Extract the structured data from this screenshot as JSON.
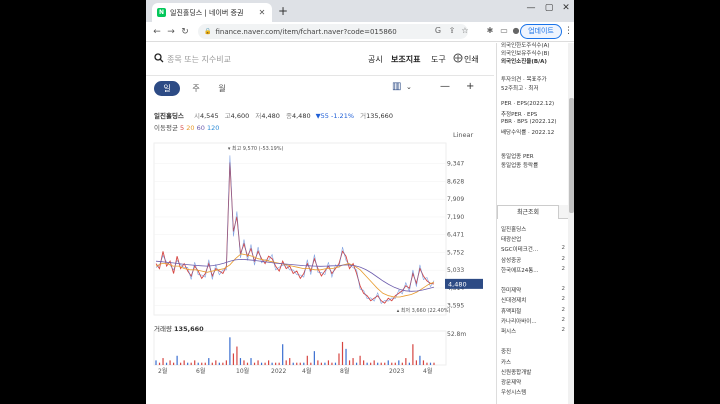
{
  "browser": {
    "tab_title": "일진홀딩스 | 네이버 증권",
    "favicon_letter": "N",
    "url": "finance.naver.com/item/fchart.naver?code=015860",
    "update_label": "업데이트"
  },
  "toolbar": {
    "search_placeholder": "종목 또는 지수비교",
    "menu": [
      "공시",
      "보조지표",
      "도구"
    ],
    "print_label": "인쇄"
  },
  "periods": [
    "일",
    "주",
    "월"
  ],
  "quote": {
    "name": "일진홀딩스",
    "open_label": "시",
    "open": "4,545",
    "high_label": "고",
    "high": "4,600",
    "low_label": "저",
    "low": "4,480",
    "close_label": "종",
    "close": "4,480",
    "change": "▼55 -1.21%",
    "volume_label": "거",
    "volume": "135,660"
  },
  "moving_average": {
    "label": "이동평균",
    "periods": [
      "5",
      "20",
      "60",
      "120"
    ]
  },
  "scale_mode": "Linear",
  "chart_data": {
    "type": "line",
    "y_ticks": [
      "9,347",
      "8,628",
      "7,909",
      "7,190",
      "6,471",
      "5,752",
      "5,033",
      "4,314",
      "3,595"
    ],
    "x_ticks": [
      "2월",
      "6월",
      "10월",
      "2022",
      "4월",
      "8월",
      "2023",
      "4월"
    ],
    "last_price": "4,480",
    "max_annotation": "최고 9,570 (-53.19%)",
    "min_annotation": "최저 3,660 (22.40%)",
    "volume_label": "거래량",
    "volume_value": "135,660",
    "volume_tick": "52.8m",
    "close": [
      5300,
      5100,
      5800,
      5200,
      5400,
      4900,
      5600,
      5100,
      5300,
      5000,
      4800,
      5200,
      5000,
      4700,
      4900,
      5300,
      4800,
      5100,
      5000,
      4900,
      5200,
      9400,
      6600,
      7200,
      5700,
      6100,
      5600,
      5900,
      5400,
      5800,
      5500,
      5300,
      5600,
      5500,
      5200,
      5000,
      5400,
      5100,
      5200,
      4900,
      5000,
      4700,
      4900,
      5300,
      5000,
      5500,
      5100,
      4800,
      5000,
      5200,
      4900,
      5100,
      5300,
      5800,
      5600,
      5100,
      5300,
      4900,
      4400,
      4100,
      4000,
      3800,
      3900,
      4000,
      3800,
      3700,
      3900,
      3800,
      4000,
      4100,
      4200,
      4400,
      4300,
      4900,
      4500,
      5100,
      4800,
      4600,
      4500,
      4480
    ],
    "ma_fast": [
      5200,
      5300,
      5300,
      5200,
      5200,
      5100,
      5050,
      5050,
      5000,
      4950,
      5000,
      5050,
      5100,
      5250,
      5500,
      5700,
      5650,
      5600,
      5500,
      5450,
      5400,
      5350,
      5300,
      5250,
      5200,
      5150,
      5100,
      5100,
      5050,
      5050,
      5100,
      5100,
      5150,
      5250,
      5300,
      5200,
      5050,
      4800,
      4550,
      4300,
      4100,
      4000,
      3950,
      3950,
      4000,
      4050,
      4150,
      4300,
      4450,
      4550
    ],
    "ma_slow": [
      5400,
      5380,
      5350,
      5330,
      5300,
      5270,
      5250,
      5230,
      5210,
      5200,
      5220,
      5260,
      5320,
      5400,
      5450,
      5470,
      5460,
      5440,
      5410,
      5380,
      5350,
      5320,
      5300,
      5280,
      5260,
      5240,
      5220,
      5210,
      5200,
      5190,
      5200,
      5210,
      5220,
      5240,
      5250,
      5220,
      5160,
      5060,
      4920,
      4760,
      4600,
      4460,
      4340,
      4250,
      4200,
      4180,
      4190,
      4230,
      4290,
      4350
    ],
    "volume": [
      2,
      1,
      3,
      1,
      2,
      1,
      4,
      1,
      2,
      1,
      1,
      2,
      1,
      1,
      1,
      3,
      1,
      2,
      1,
      1,
      2,
      12,
      5,
      8,
      3,
      2,
      1,
      3,
      1,
      2,
      1,
      1,
      2,
      1,
      1,
      1,
      9,
      2,
      3,
      1,
      1,
      1,
      1,
      4,
      1,
      6,
      2,
      1,
      1,
      2,
      1,
      1,
      5,
      10,
      7,
      2,
      3,
      1,
      4,
      2,
      1,
      1,
      2,
      1,
      1,
      1,
      2,
      1,
      1,
      2,
      1,
      3,
      1,
      9,
      2,
      4,
      2,
      1,
      1,
      1
    ],
    "colors": {
      "price": "#d64541",
      "fast": "#e89a2c",
      "slow": "#6d5dad",
      "last_box": "#2d4b85"
    }
  },
  "panel": {
    "foreign": [
      "외국인한도주식수(A)",
      "외국인보유주식수(B)",
      "외국인소진율(B/A)"
    ],
    "opinion": [
      "투자의견 · 목표주가",
      "52주최고 · 최저"
    ],
    "per_lines": [
      "PER · EPS(2022.12)",
      "추정PER · EPS",
      "PBR · BPS (2022.12)",
      "배당수익률 · 2022.12"
    ],
    "industry": [
      "동일업종 PER",
      "동일업종 등락률"
    ],
    "recent_title": "최근조회",
    "recent": [
      {
        "name": "일진홀딩스",
        "num": ""
      },
      {
        "name": "태광산업",
        "num": ""
      },
      {
        "name": "SGC이테크건...",
        "num": "2"
      },
      {
        "name": "삼성중공",
        "num": "2"
      },
      {
        "name": "한국에프24통...",
        "num": "2"
      },
      {
        "name": "",
        "num": ""
      },
      {
        "name": "한미제약",
        "num": "2"
      },
      {
        "name": "신대경제치",
        "num": "2"
      },
      {
        "name": "휴맥피철",
        "num": "2"
      },
      {
        "name": "카나리아바이...",
        "num": "2"
      },
      {
        "name": "퍼시스",
        "num": "2"
      },
      {
        "name": "",
        "num": ""
      },
      {
        "name": "중진",
        "num": ""
      },
      {
        "name": "카스",
        "num": ""
      },
      {
        "name": "신원종합개발",
        "num": ""
      },
      {
        "name": "광문제약",
        "num": ""
      },
      {
        "name": "우성시스템",
        "num": ""
      }
    ]
  }
}
